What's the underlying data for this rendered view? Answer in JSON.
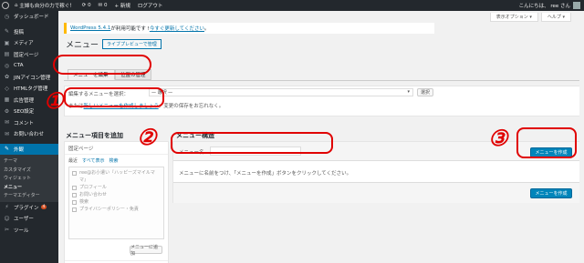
{
  "adminbar": {
    "site_name": "主婦も自分の力で稼ぐ！",
    "updates": "0",
    "comments": "0",
    "new": "+ 新規",
    "logout": "ログアウト",
    "greeting": "こんにちは、 ree さん"
  },
  "sidebar": {
    "items": [
      {
        "icon": "dashboard-icon",
        "glyph": "◷",
        "label": "ダッシュボード"
      },
      {
        "icon": "pin-icon",
        "glyph": "✎",
        "label": "投稿"
      },
      {
        "icon": "media-icon",
        "glyph": "▣",
        "label": "メディア"
      },
      {
        "icon": "page-icon",
        "glyph": "▤",
        "label": "固定ページ"
      },
      {
        "icon": "cta-icon",
        "glyph": "◎",
        "label": "CTA"
      },
      {
        "icon": "jin-icon",
        "glyph": "✿",
        "label": "JINアイコン管理"
      },
      {
        "icon": "html-icon",
        "glyph": "◇",
        "label": "HTMLタグ管理"
      },
      {
        "icon": "ad-icon",
        "glyph": "▦",
        "label": "広告管理"
      },
      {
        "icon": "seo-icon",
        "glyph": "⚙",
        "label": "SEO設定"
      },
      {
        "icon": "comment-icon",
        "glyph": "✉",
        "label": "コメント"
      },
      {
        "icon": "inquiry-icon",
        "glyph": "✉",
        "label": "お問い合わせ"
      }
    ],
    "appearance": {
      "icon": "brush-icon",
      "glyph": "✎",
      "label": "外観"
    },
    "submenu": [
      "テーマ",
      "カスタマイズ",
      "ウィジェット",
      "メニュー",
      "テーマエディター"
    ],
    "plugins": {
      "icon": "plugin-icon",
      "glyph": "⚡",
      "label": "プラグイン",
      "badge": "4"
    },
    "users": {
      "icon": "user-icon",
      "glyph": "☺",
      "label": "ユーザー"
    },
    "tools": {
      "icon": "tools-icon",
      "glyph": "✂",
      "label": "ツール"
    }
  },
  "screen_options": {
    "options": "表示オプション ▾",
    "help": "ヘルプ ▾"
  },
  "notice": {
    "link1": "WordPress 5.4.1",
    "text": " が利用可能です ! ",
    "link2": "今すぐ更新してください",
    "end": "。"
  },
  "page": {
    "title": "メニュー",
    "live_preview": "ライブプレビューで管理"
  },
  "tabs": {
    "edit": "メニューを編集",
    "manage": "位置の管理"
  },
  "manage": {
    "select_label": "編集するメニューを選択：",
    "select_value": "— 選択 —",
    "select_button": "選択",
    "hint_prefix": "または",
    "hint_link": "新しいメニューを作成しましょう",
    "hint_suffix": "。変更の保存をお忘れなく。"
  },
  "add_items": {
    "heading": "メニュー項目を追加",
    "section_pages": "固定ページ",
    "tabs": [
      "最近",
      "すべて表示",
      "検索"
    ],
    "items": [
      "ree@お小遣い『ハッピーズマイルママ』",
      "プロフィール",
      "お問い合わせ",
      "検索",
      "プライバシーポリシー・免責"
    ],
    "add_button": "メニューに追加",
    "section_posts": "投稿"
  },
  "structure": {
    "heading": "メニュー構造",
    "name_label": "メニュー名",
    "name_value": "",
    "create_button": "メニューを作成",
    "instruction": "メニューに名前をつけ、「メニューを作成」ボタンをクリックしてください。",
    "create_button_bottom": "メニューを作成"
  },
  "annotations": {
    "n1": "①",
    "n2": "②",
    "n3": "③",
    "color": "#e00000"
  }
}
